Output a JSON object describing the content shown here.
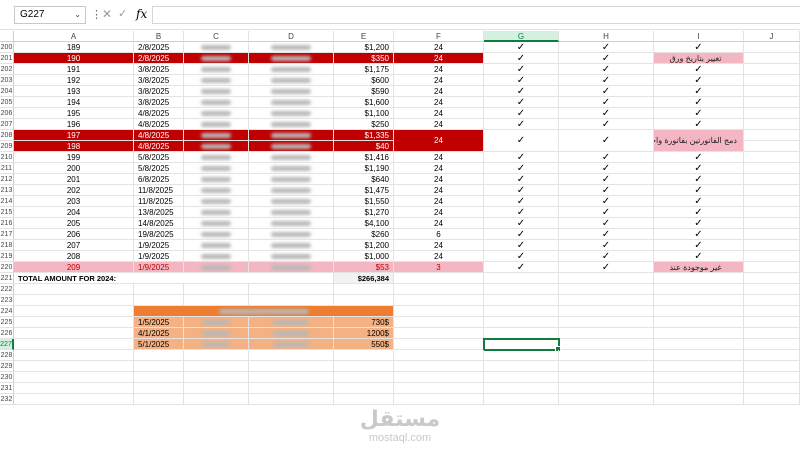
{
  "formula_bar": {
    "name_box": "G227",
    "formula": "",
    "fx": "fx",
    "cancel_icon": "✕",
    "enter_icon": "✓",
    "menu_icon": "⋮",
    "dropdown_icon": "⌄"
  },
  "columns": [
    "A",
    "B",
    "C",
    "D",
    "E",
    "F",
    "G",
    "H",
    "I",
    "J"
  ],
  "selected_column": "G",
  "check": "✓",
  "rows": [
    {
      "n": "200",
      "a": "189",
      "b": "2/8/2025",
      "e": "$1,200",
      "f": "24",
      "g": true,
      "h": true,
      "i": "check"
    },
    {
      "n": "201",
      "a": "190",
      "b": "2/8/2025",
      "e": "$350",
      "f": "24",
      "g": true,
      "h": true,
      "i": "note",
      "note": "تغيير بتاريخ ورق",
      "hl": "red"
    },
    {
      "n": "202",
      "a": "191",
      "b": "3/8/2025",
      "e": "$1,175",
      "f": "24",
      "g": true,
      "h": true,
      "i": "check"
    },
    {
      "n": "203",
      "a": "192",
      "b": "3/8/2025",
      "e": "$600",
      "f": "24",
      "g": true,
      "h": true,
      "i": "check"
    },
    {
      "n": "204",
      "a": "193",
      "b": "3/8/2025",
      "e": "$590",
      "f": "24",
      "g": true,
      "h": true,
      "i": "check"
    },
    {
      "n": "205",
      "a": "194",
      "b": "3/8/2025",
      "e": "$1,600",
      "f": "24",
      "g": true,
      "h": true,
      "i": "check"
    },
    {
      "n": "206",
      "a": "195",
      "b": "4/8/2025",
      "e": "$1,100",
      "f": "24",
      "g": true,
      "h": true,
      "i": "check"
    },
    {
      "n": "207",
      "a": "196",
      "b": "4/8/2025",
      "e": "$250",
      "f": "24",
      "g": true,
      "h": true,
      "i": "check"
    },
    {
      "n": "208",
      "a": "197",
      "b": "4/8/2025",
      "e": "$1,335",
      "f": "24",
      "g": true,
      "h": true,
      "i": "merge",
      "note": "دمج الفاتورتين بفاتورة واحدة",
      "hl": "red"
    },
    {
      "n": "209",
      "a": "198",
      "b": "4/8/2025",
      "e": "$40",
      "f": "",
      "g": false,
      "h": false,
      "i": "merged",
      "hl": "red"
    },
    {
      "n": "210",
      "a": "199",
      "b": "5/8/2025",
      "e": "$1,416",
      "f": "24",
      "g": true,
      "h": true,
      "i": "check"
    },
    {
      "n": "211",
      "a": "200",
      "b": "5/8/2025",
      "e": "$1,190",
      "f": "24",
      "g": true,
      "h": true,
      "i": "check"
    },
    {
      "n": "212",
      "a": "201",
      "b": "6/8/2025",
      "e": "$640",
      "f": "24",
      "g": true,
      "h": true,
      "i": "check"
    },
    {
      "n": "213",
      "a": "202",
      "b": "11/8/2025",
      "e": "$1,475",
      "f": "24",
      "g": true,
      "h": true,
      "i": "check"
    },
    {
      "n": "214",
      "a": "203",
      "b": "11/8/2025",
      "e": "$1,550",
      "f": "24",
      "g": true,
      "h": true,
      "i": "check"
    },
    {
      "n": "215",
      "a": "204",
      "b": "13/8/2025",
      "e": "$1,270",
      "f": "24",
      "g": true,
      "h": true,
      "i": "check"
    },
    {
      "n": "216",
      "a": "205",
      "b": "14/8/2025",
      "e": "$4,100",
      "f": "24",
      "g": true,
      "h": true,
      "i": "check"
    },
    {
      "n": "217",
      "a": "206",
      "b": "19/8/2025",
      "e": "$260",
      "f": "6",
      "g": true,
      "h": true,
      "i": "check"
    },
    {
      "n": "218",
      "a": "207",
      "b": "1/9/2025",
      "e": "$1,200",
      "f": "24",
      "g": true,
      "h": true,
      "i": "check"
    },
    {
      "n": "219",
      "a": "208",
      "b": "1/9/2025",
      "e": "$1,000",
      "f": "24",
      "g": true,
      "h": true,
      "i": "check"
    },
    {
      "n": "220",
      "a": "209",
      "b": "1/9/2025",
      "e": "$53",
      "f": "3",
      "g": true,
      "h": true,
      "i": "note",
      "note": "غير موجودة عند",
      "hl": "pink"
    }
  ],
  "total_row": {
    "n": "221",
    "label": "TOTAL AMOUNT FOR 2024:",
    "value": "$266,384"
  },
  "empty_rows": [
    "222",
    "223",
    "224",
    "225",
    "226",
    "227",
    "228",
    "229",
    "230",
    "231",
    "232"
  ],
  "summary": [
    {
      "row": "225",
      "date": "1/5/2025",
      "amount": "730$"
    },
    {
      "row": "226",
      "date": "4/1/2025",
      "amount": "1200$"
    },
    {
      "row": "227",
      "date": "5/1/2025",
      "amount": "550$"
    }
  ],
  "selected_row": "227",
  "watermark": {
    "arabic": "مستقل",
    "latin": "mostaql.com"
  },
  "colors": {
    "red": "#c00000",
    "pink": "#f4b6c2",
    "orange_dark": "#ed7d31",
    "orange_light": "#f4b183",
    "select": "#107c41"
  }
}
